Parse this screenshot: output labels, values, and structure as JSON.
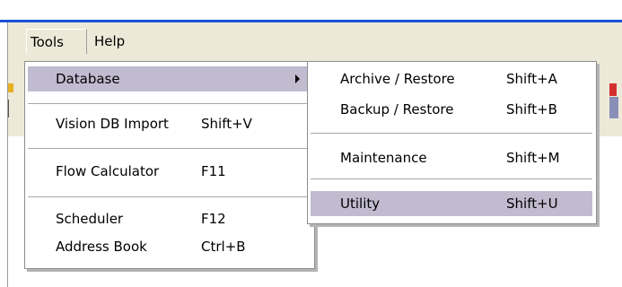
{
  "menubar": {
    "tools_label": "Tools",
    "help_label": "Help"
  },
  "tools_menu": {
    "items": [
      {
        "label": "Database",
        "has_submenu": true
      },
      {
        "label": "Vision DB Import",
        "shortcut": "Shift+V"
      },
      {
        "label": "Flow Calculator",
        "shortcut": "F11"
      },
      {
        "label": "Scheduler",
        "shortcut": "F12"
      },
      {
        "label": "Address Book",
        "shortcut": "Ctrl+B"
      }
    ]
  },
  "database_submenu": {
    "items": [
      {
        "label": "Archive / Restore",
        "shortcut": "Shift+A"
      },
      {
        "label": "Backup / Restore",
        "shortcut": "Shift+B"
      },
      {
        "label": "Maintenance",
        "shortcut": "Shift+M"
      },
      {
        "label": "Utility",
        "shortcut": "Shift+U"
      }
    ]
  },
  "colors": {
    "title_line": "#1a50d8",
    "menu_bg": "#ece9d8",
    "highlight": "#c1bbd0"
  },
  "icons": [
    "submenu-arrow-icon"
  ]
}
